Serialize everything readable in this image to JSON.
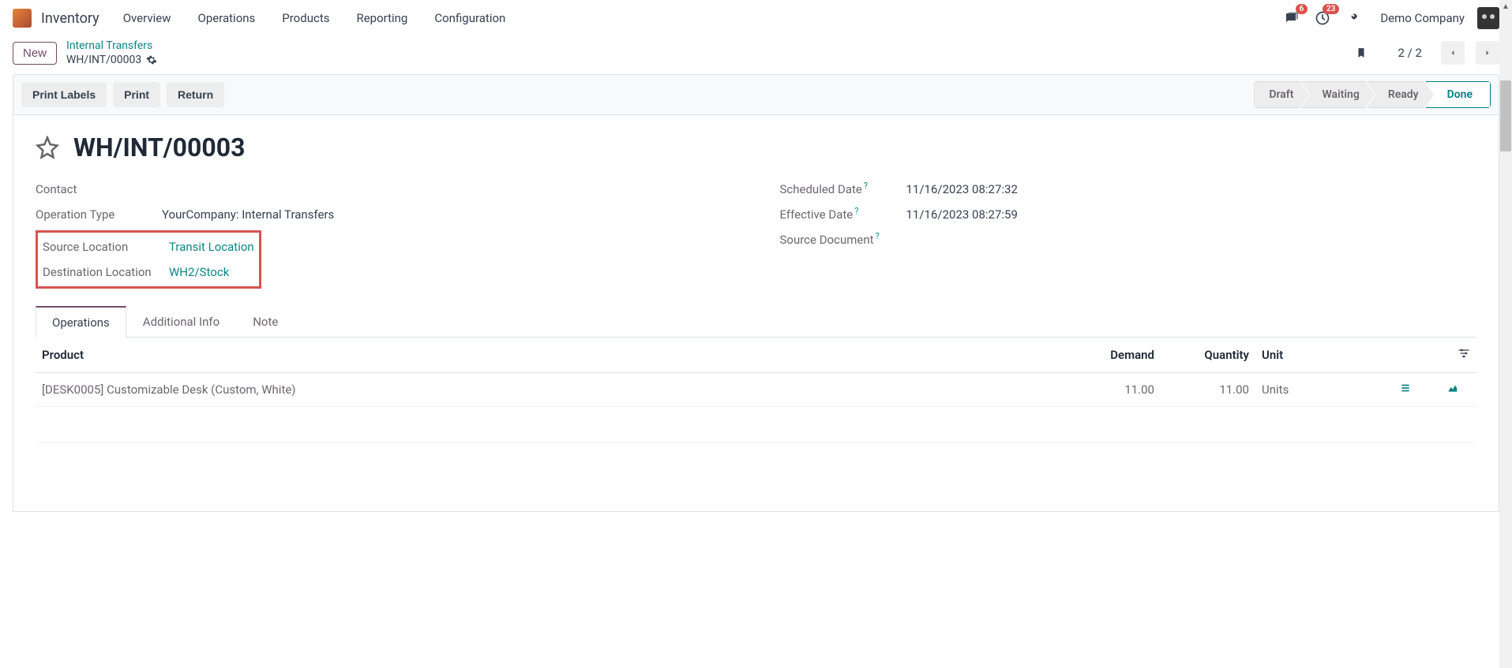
{
  "app": {
    "name": "Inventory"
  },
  "nav": {
    "items": [
      "Overview",
      "Operations",
      "Products",
      "Reporting",
      "Configuration"
    ]
  },
  "topbar": {
    "msg_count": "6",
    "clock_count": "23",
    "company": "Demo Company"
  },
  "crumb": {
    "new_label": "New",
    "parent": "Internal Transfers",
    "current": "WH/INT/00003"
  },
  "pager": {
    "text": "2 / 2"
  },
  "actions": {
    "print_labels": "Print Labels",
    "print": "Print",
    "return": "Return"
  },
  "status": {
    "draft": "Draft",
    "waiting": "Waiting",
    "ready": "Ready",
    "done": "Done"
  },
  "record": {
    "title": "WH/INT/00003",
    "left": {
      "contact_label": "Contact",
      "contact_value": "",
      "optype_label": "Operation Type",
      "optype_value": "YourCompany: Internal Transfers",
      "srcloc_label": "Source Location",
      "srcloc_value": "Transit Location",
      "dstloc_label": "Destination Location",
      "dstloc_value": "WH2/Stock"
    },
    "right": {
      "sched_label": "Scheduled Date",
      "sched_value": "11/16/2023 08:27:32",
      "eff_label": "Effective Date",
      "eff_value": "11/16/2023 08:27:59",
      "srcdoc_label": "Source Document",
      "srcdoc_value": ""
    }
  },
  "tabs": {
    "operations": "Operations",
    "additional": "Additional Info",
    "note": "Note"
  },
  "table": {
    "head": {
      "product": "Product",
      "demand": "Demand",
      "quantity": "Quantity",
      "unit": "Unit"
    },
    "rows": [
      {
        "product": "[DESK0005] Customizable Desk (Custom, White)",
        "demand": "11.00",
        "qty": "11.00",
        "unit": "Units"
      }
    ]
  }
}
